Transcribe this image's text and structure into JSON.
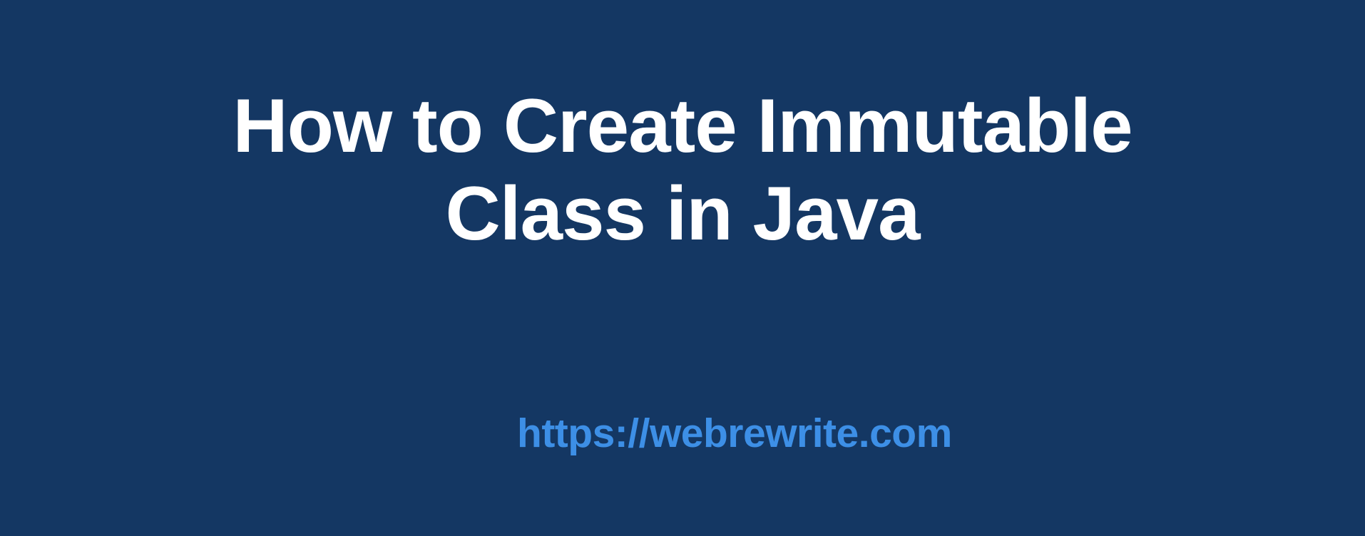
{
  "banner": {
    "title_line1": "How to Create Immutable",
    "title_line2": "Class in Java",
    "url": "https://webrewrite.com"
  }
}
